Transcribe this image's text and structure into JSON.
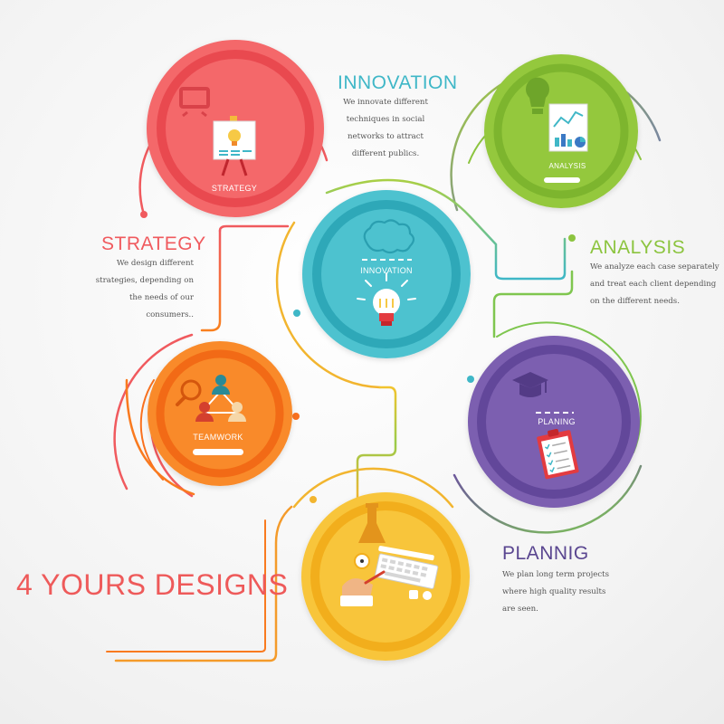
{
  "main_title": "4 YOURS DESIGNS",
  "colors": {
    "strategy": "#f05a5e",
    "innovation": "#3fb7c7",
    "analysis": "#8cc43f",
    "teamwork": "#f9711f",
    "planing": "#6b4fa0",
    "plannig": "#f5bb25",
    "connector": "#ecbf3a"
  },
  "nodes": {
    "strategy": {
      "heading": "STRATEGY",
      "circle_label": "STRATEGY",
      "icon": "presentation-easel-icon",
      "description": [
        "We design different",
        "strategies, depending on",
        "the needs of our",
        "consumers.."
      ]
    },
    "innovation": {
      "heading": "INNOVATION",
      "circle_label": "INNOVATION",
      "icon": "brain-lightbulb-icon",
      "description": [
        "We innovate different",
        "techniques in social",
        "networks to attract",
        "different publics."
      ]
    },
    "analysis": {
      "heading": "ANALYSIS",
      "circle_label": "ANALYSIS",
      "icon": "lightbulb-chart-icon",
      "description": [
        "We analyze each case separately",
        "and treat each client depending",
        "on the different needs."
      ]
    },
    "teamwork": {
      "circle_label": "TEAMWORK",
      "icon": "team-network-icon"
    },
    "planing": {
      "circle_label": "PLANING",
      "icon": "graduation-cap-clipboard-icon"
    },
    "plannig": {
      "heading": "PLANNIG",
      "icon": "desk-workspace-icon",
      "description": [
        "We plan long term projects",
        "where high quality results",
        "are seen."
      ]
    }
  }
}
